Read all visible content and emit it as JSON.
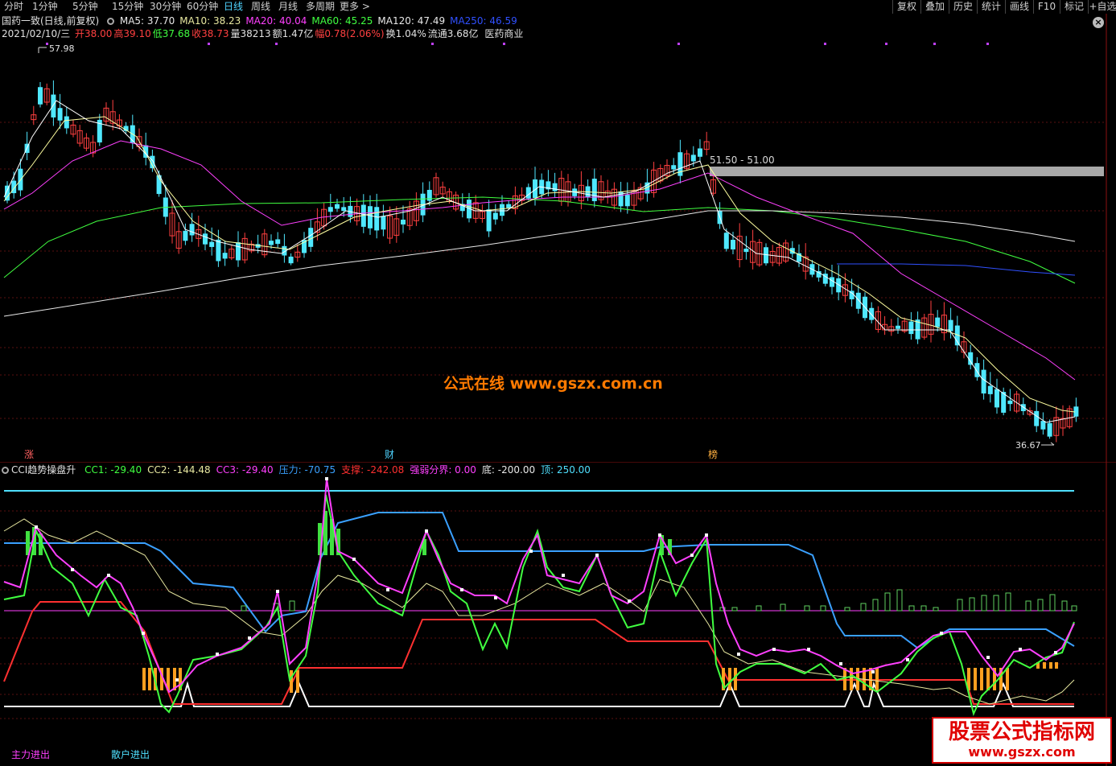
{
  "toolbar": {
    "periods": [
      "分时",
      "1分钟",
      "5分钟",
      "15分钟",
      "30分钟",
      "60分钟",
      "日线",
      "周线",
      "月线",
      "多周期",
      "更多 >"
    ],
    "active_period": "日线",
    "tools": [
      "复权",
      "叠加",
      "历史",
      "统计",
      "画线",
      "F10",
      "标记",
      "+自选"
    ]
  },
  "stock": {
    "name": "国药一致(日线,前复权)",
    "date": "2021/02/10/三",
    "industry": "医药商业"
  },
  "ma": [
    {
      "label": "MA5: 37.70",
      "color": "#e8e8e8"
    },
    {
      "label": "MA10: 38.23",
      "color": "#e8e8a0"
    },
    {
      "label": "MA20: 40.04",
      "color": "#ff40ff"
    },
    {
      "label": "MA60: 45.25",
      "color": "#40ff40"
    },
    {
      "label": "MA120: 47.49",
      "color": "#e8e8e8"
    },
    {
      "label": "MA250: 46.59",
      "color": "#3050ff"
    }
  ],
  "quote": [
    {
      "label": "开",
      "value": "38.00",
      "color": "#ff4040"
    },
    {
      "label": "高",
      "value": "39.10",
      "color": "#ff4040"
    },
    {
      "label": "低",
      "value": "37.68",
      "color": "#40ff40"
    },
    {
      "label": "收",
      "value": "38.73",
      "color": "#ff4040"
    },
    {
      "label": "量",
      "value": "38213",
      "color": "#e0e0e0"
    },
    {
      "label": "额",
      "value": "1.47亿",
      "color": "#e0e0e0"
    },
    {
      "label": "幅",
      "value": "0.78(2.06%)",
      "color": "#ff4040"
    },
    {
      "label": "换",
      "value": "1.04%",
      "color": "#e0e0e0"
    },
    {
      "label": "流通",
      "value": "3.68亿",
      "color": "#e0e0e0"
    }
  ],
  "annotations": {
    "high": "57.98",
    "low": "36.67",
    "zone": "51.50 - 51.00"
  },
  "events": [
    "涨",
    "财",
    "榜"
  ],
  "indicator": {
    "name": "CCI趋势操盘升",
    "values": [
      {
        "label": "CC1: -29.40",
        "color": "#40ff40"
      },
      {
        "label": "CC2: -144.48",
        "color": "#e8e8a0"
      },
      {
        "label": "CC3: -29.40",
        "color": "#ff40ff"
      },
      {
        "label": "压力: -70.75",
        "color": "#3aa0ff"
      },
      {
        "label": "支撑: -242.08",
        "color": "#ff3030"
      },
      {
        "label": "强弱分界: 0.00",
        "color": "#ff40ff"
      },
      {
        "label": "底: -200.00",
        "color": "#e8e8e8"
      },
      {
        "label": "顶: 250.00",
        "color": "#4fe0ff"
      }
    ]
  },
  "bottom_labels": [
    "主力进出",
    "散户进出"
  ],
  "watermark": "公式在线  www.gszx.com.cn",
  "logo": {
    "title": "股票公式指标网",
    "url": "www.gszx.com"
  },
  "colors": {
    "up": "#ff4040",
    "down": "#4fe8ff",
    "ma5": "#ffffff",
    "ma10": "#ffffa0",
    "ma20": "#ff40ff",
    "ma60": "#40ff40",
    "ma120": "#e8e8e8",
    "ma250": "#3050ff"
  }
}
